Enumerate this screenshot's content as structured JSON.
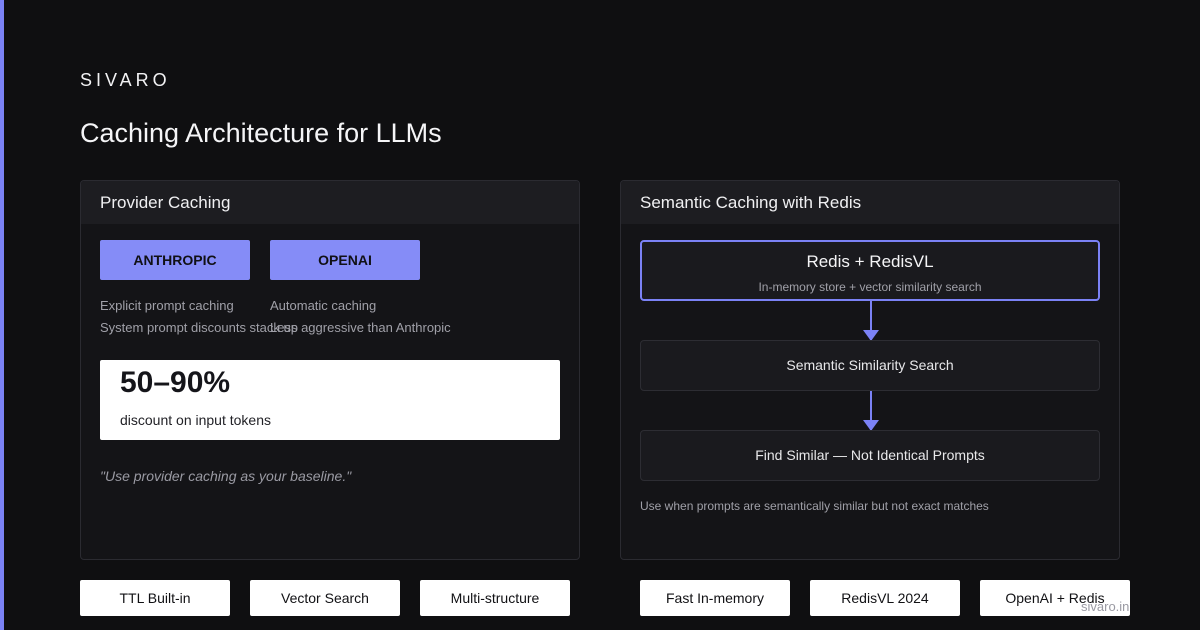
{
  "brand": "SIVARO",
  "title": "Caching Architecture for LLMs",
  "provider_panel": {
    "heading": "Provider Caching",
    "providers": [
      {
        "name": "ANTHROPIC",
        "lines": [
          "Explicit prompt caching",
          "System prompt discounts stack up"
        ]
      },
      {
        "name": "OPENAI",
        "lines": [
          "Automatic caching",
          "Less aggressive than Anthropic"
        ]
      }
    ],
    "stat": {
      "value": "50–90%",
      "label": "discount on input tokens"
    },
    "quote": "\"Use provider caching as your baseline.\""
  },
  "semantic_panel": {
    "heading": "Semantic Caching with Redis",
    "flow": [
      {
        "title": "Redis + RedisVL",
        "subtitle": "In-memory store + vector similarity search"
      },
      {
        "title": "Semantic Similarity Search"
      },
      {
        "title": "Find Similar — Not Identical Prompts"
      }
    ],
    "note": "Use when prompts are semantically similar but not exact matches"
  },
  "tags": [
    "TTL Built-in",
    "Vector Search",
    "Multi-structure",
    "Fast In-memory",
    "RedisVL 2024",
    "OpenAI + Redis"
  ],
  "footer": "sivaro.in",
  "colors": {
    "accent": "#7b82f5",
    "background": "#0f0f11",
    "panel": "#141417"
  }
}
